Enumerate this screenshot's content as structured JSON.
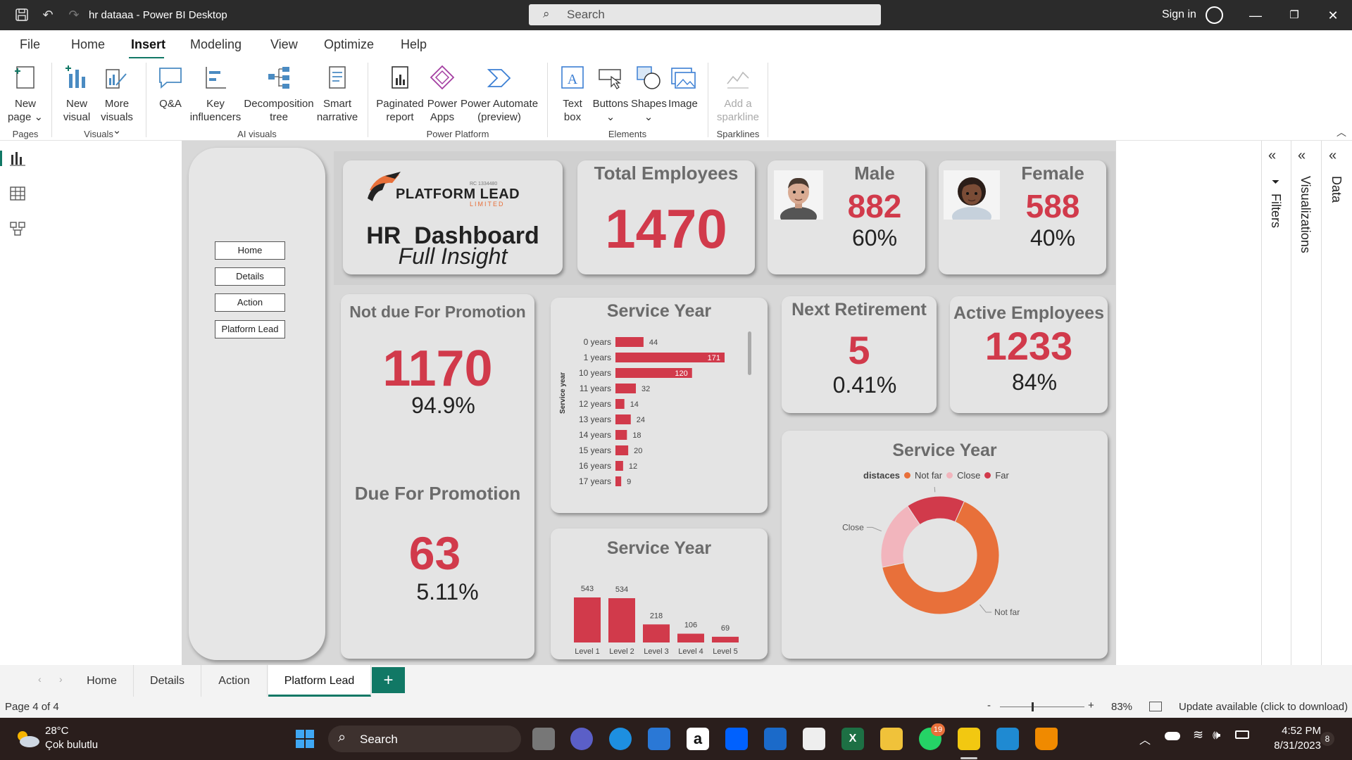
{
  "window": {
    "title": "hr dataaa - Power BI Desktop",
    "search_placeholder": "Search",
    "sign_in": "Sign in"
  },
  "menu": [
    "File",
    "Home",
    "Insert",
    "Modeling",
    "View",
    "Optimize",
    "Help"
  ],
  "menu_active": "Insert",
  "ribbon": {
    "buttons": [
      {
        "l1": "New",
        "l2": "page ⌄",
        "icon": "new-page-icon"
      },
      {
        "l1": "New",
        "l2": "visual",
        "icon": "new-visual-icon"
      },
      {
        "l1": "More",
        "l2": "visuals ⌄",
        "icon": "more-visuals-icon"
      },
      {
        "l1": "Q&A",
        "l2": "",
        "icon": "qna-icon"
      },
      {
        "l1": "Key",
        "l2": "influencers",
        "icon": "key-influencers-icon"
      },
      {
        "l1": "Decomposition",
        "l2": "tree",
        "icon": "decomposition-tree-icon"
      },
      {
        "l1": "Smart",
        "l2": "narrative",
        "icon": "smart-narrative-icon"
      },
      {
        "l1": "Paginated",
        "l2": "report",
        "icon": "paginated-report-icon"
      },
      {
        "l1": "Power",
        "l2": "Apps",
        "icon": "power-apps-icon"
      },
      {
        "l1": "Power Automate",
        "l2": "(preview)",
        "icon": "power-automate-icon"
      },
      {
        "l1": "Text",
        "l2": "box",
        "icon": "text-box-icon"
      },
      {
        "l1": "Buttons",
        "l2": "⌄",
        "icon": "buttons-icon"
      },
      {
        "l1": "Shapes",
        "l2": "⌄",
        "icon": "shapes-icon"
      },
      {
        "l1": "Image",
        "l2": "",
        "icon": "image-icon"
      },
      {
        "l1": "Add a",
        "l2": "sparkline",
        "icon": "sparkline-icon"
      }
    ],
    "groups": [
      "Pages",
      "Visuals",
      "AI visuals",
      "Power Platform",
      "Elements",
      "Sparklines"
    ]
  },
  "nav_buttons": [
    "Home",
    "Details",
    "Action",
    "Platform Lead"
  ],
  "logo": {
    "name": "PLATFORM LEAD",
    "sub": "LIMITED",
    "rc": "RC 1334480"
  },
  "header": {
    "title": "HR  Dashboard",
    "subtitle": "Full Insight"
  },
  "kpis": {
    "total": {
      "title": "Total Employees",
      "value": "1470"
    },
    "male": {
      "title": "Male",
      "value": "882",
      "pct": "60%"
    },
    "female": {
      "title": "Female",
      "value": "588",
      "pct": "40%"
    },
    "not_due": {
      "title": "Not due For Promotion",
      "value": "1170",
      "pct": "94.9%"
    },
    "due": {
      "title": "Due For Promotion",
      "value": "63",
      "pct": "5.11%"
    },
    "retirement": {
      "title": "Next Retirement",
      "value": "5",
      "pct": "0.41%"
    },
    "active": {
      "title": "Active Employees",
      "value": "1233",
      "pct": "84%"
    }
  },
  "colors": {
    "accent": "#d13a4b",
    "orange": "#e8703a",
    "pink": "#f2b5bd",
    "brand": "#117865"
  },
  "chart_data": [
    {
      "type": "bar",
      "orientation": "horizontal",
      "title": "Service Year",
      "ylabel": "Service year",
      "categories": [
        "0 years",
        "1 years",
        "10 years",
        "11 years",
        "12 years",
        "13 years",
        "14 years",
        "15 years",
        "16 years",
        "17 years"
      ],
      "values": [
        44,
        171,
        120,
        32,
        14,
        24,
        18,
        20,
        12,
        9
      ]
    },
    {
      "type": "bar",
      "title": "Service Year",
      "categories": [
        "Level 1",
        "Level 2",
        "Level 3",
        "Level 4",
        "Level 5"
      ],
      "values": [
        543,
        534,
        218,
        106,
        69
      ]
    },
    {
      "type": "pie",
      "title": "Service Year",
      "legend_title": "distaces",
      "legend_position": "top",
      "categories": [
        "Not far",
        "Close",
        "Far"
      ],
      "values": [
        65,
        19,
        16
      ],
      "colors": [
        "#e8703a",
        "#f2b5bd",
        "#d13a4b"
      ]
    }
  ],
  "tabs": [
    "Home",
    "Details",
    "Action",
    "Platform Lead"
  ],
  "active_tab": "Platform Lead",
  "status": {
    "page": "Page 4 of 4",
    "zoom": "83%",
    "update": "Update available (click to download)"
  },
  "panes": [
    "Filters",
    "Visualizations",
    "Data"
  ],
  "taskbar": {
    "temp": "28°C",
    "weather": "Çok bulutlu",
    "search": "Search",
    "time": "4:52 PM",
    "date": "8/31/2023",
    "whatsapp_badge": "19",
    "notif": "8"
  }
}
